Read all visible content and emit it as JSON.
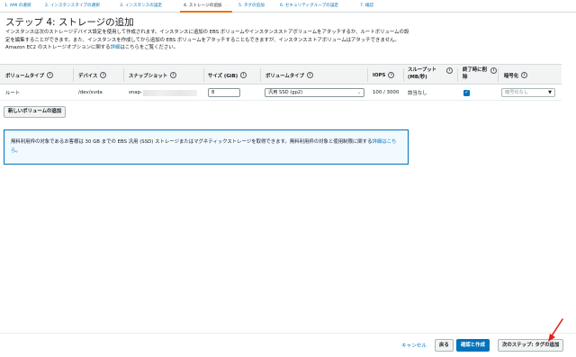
{
  "wizard": {
    "steps": [
      {
        "label": "1. AMI の選択"
      },
      {
        "label": "2. インスタンスタイプの選択"
      },
      {
        "label": "3. インスタンスの設定"
      },
      {
        "label": "4. ストレージの追加"
      },
      {
        "label": "5. タグの追加"
      },
      {
        "label": "6. セキュリティグループの設定"
      },
      {
        "label": "7. 確認"
      }
    ],
    "active_index": 3
  },
  "page": {
    "title": "ステップ 4: ストレージの追加",
    "desc_main": "インスタンスは次のストレージデバイス設定を使用して作成されます。インスタンスに追加の EBS ボリュームやインスタンスストアボリュームをアタッチするか、ルートボリュームの設定を編集することができます。また、インスタンスを作成してから追加の EBS ボリュームをアタッチすることもできますが、インスタンスストアボリュームはアタッチできません。Amazon EC2 のストレージオプションに関する",
    "desc_link": "詳細",
    "desc_tail": "はこちらをご覧ください。"
  },
  "table": {
    "columns": {
      "volume_type": "ボリュームタイプ",
      "device": "デバイス",
      "snapshot": "スナップショット",
      "size": "サイズ (GiB)",
      "volume_kind": "ボリュームタイプ",
      "iops": "IOPS",
      "throughput": "スループット (MB/秒)",
      "delete_on_termination": "終了時に削除",
      "encryption": "暗号化"
    },
    "info_icon": "i",
    "row": {
      "volume_type": "ルート",
      "device": "/dev/xvda",
      "snapshot": "snap-",
      "size": "8",
      "volume_kind": "汎用 SSD (gp2)",
      "iops": "100 / 3000",
      "throughput": "該当なし",
      "delete_on_termination": true,
      "encryption": "暗号化なし"
    }
  },
  "add_volume_button": "新しいボリュームの追加",
  "info_box": {
    "text": "無料利用枠の対象であるお客様は 30 GB までの EBS 汎用 (SSD) ストレージまたはマグネティックストレージを取得できます。無料利用枠の対象と使用制限に関する",
    "link": "詳細はこちら",
    "tail": "。"
  },
  "footer": {
    "cancel": "キャンセル",
    "back": "戻る",
    "review_launch": "確認と作成",
    "next": "次のステップ: タグの追加"
  },
  "colors": {
    "link": "#0073bb",
    "active_step": "#ec7211",
    "arrow": "#e41e1e"
  }
}
